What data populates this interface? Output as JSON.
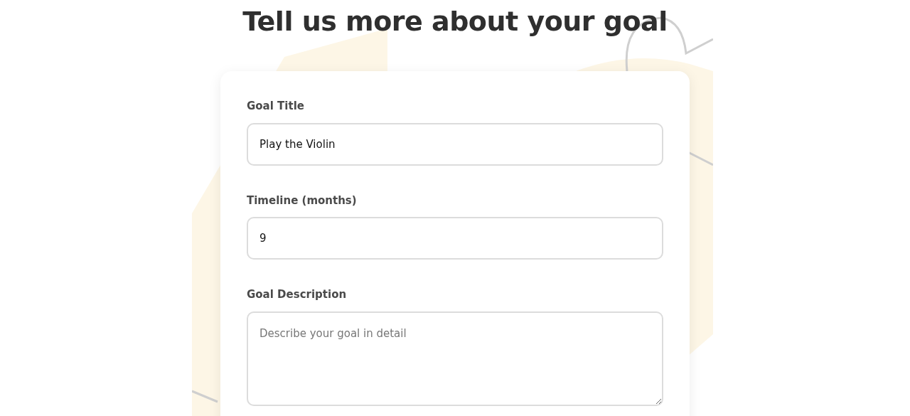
{
  "heading": "Tell us more about your goal",
  "fields": [
    {
      "kind": "input",
      "label": "Goal Title",
      "value": "Play the Violin"
    },
    {
      "kind": "input",
      "label": "Timeline (months)",
      "value": "9"
    },
    {
      "kind": "textarea",
      "label": "Goal Description",
      "placeholder": "Describe your goal in detail"
    }
  ]
}
